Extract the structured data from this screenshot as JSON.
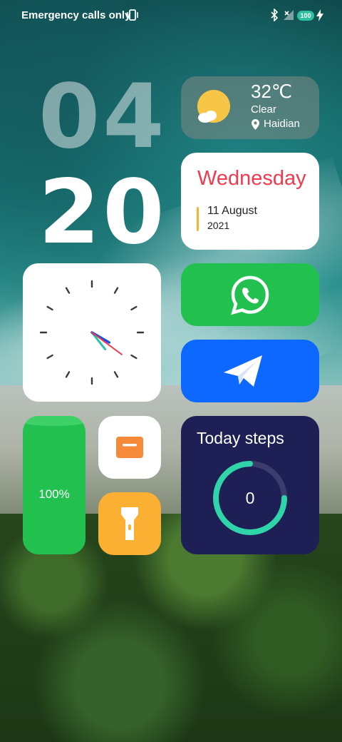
{
  "status_bar": {
    "carrier_text": "Emergency calls only",
    "battery_level": "100",
    "icons": [
      "vibrate-icon",
      "bluetooth-icon",
      "signal-icon",
      "charging-icon"
    ]
  },
  "clock": {
    "hours": "04",
    "minutes": "20"
  },
  "weather": {
    "temperature": "32℃",
    "condition": "Clear",
    "location": "Haidian",
    "icon": "sun-cloud-icon"
  },
  "calendar": {
    "weekday": "Wednesday",
    "date": "11 August",
    "year": "2021",
    "accent_color": "#f03a4f"
  },
  "analog_clock": {
    "hour": 4,
    "minute": 20
  },
  "apps": [
    {
      "name": "WhatsApp",
      "icon": "whatsapp-icon",
      "color": "#21c04f"
    },
    {
      "name": "Telegram",
      "icon": "telegram-icon",
      "color": "#0d68ff"
    }
  ],
  "battery_widget": {
    "label": "100%",
    "level": 1.0,
    "color": "#21c04f"
  },
  "tiles": [
    {
      "icon": "notes-icon",
      "color": "#ffffff"
    },
    {
      "icon": "flashlight-icon",
      "color": "#fbb033"
    }
  ],
  "steps": {
    "title": "Today steps",
    "count": "0",
    "ring_color": "#2fd4a8"
  }
}
